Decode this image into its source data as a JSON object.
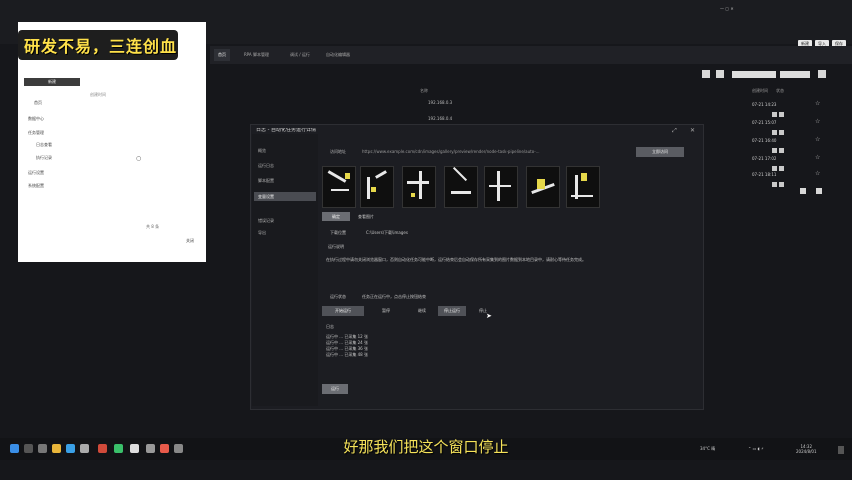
{
  "banner": {
    "text": "研发不易，三连创血"
  },
  "subtitle": "好那我们把这个窗口停止",
  "browser": {
    "tabs": [
      "首页",
      "RPA 脚本管理",
      "调试 / 运行",
      "自动化编辑器"
    ],
    "right_buttons": [
      "新建",
      "导入",
      "保存"
    ]
  },
  "list": {
    "col_a": "名称",
    "col_b": "创建时间",
    "col_c": "状态",
    "rows": [
      {
        "name": "任务 1",
        "time": "07-21 14:23"
      },
      {
        "name": "任务 2",
        "time": "07-21 15:07"
      },
      {
        "name": "任务 3",
        "time": "07-21 16:40"
      },
      {
        "name": "任务 4",
        "time": "07-21 17:02"
      },
      {
        "name": "任务 5",
        "time": "07-21 18:11"
      }
    ],
    "top_rows": [
      "192.168.0.3",
      "192.168.0.4"
    ]
  },
  "panel": {
    "button": "新建",
    "items": [
      "首页",
      "数据中心",
      "任务管理",
      "日志查看",
      "执行记录",
      "运行设置",
      "系统配置"
    ],
    "bottom_text": "共 8 条",
    "footer_button": "关闭"
  },
  "dialog": {
    "title": "日志 - 自动化任务运行详情",
    "side": [
      "概览",
      "运行日志",
      "脚本配置",
      "变量设置",
      "错误记录",
      "导出"
    ],
    "active_side": 3,
    "url_label": "访问地址",
    "url_text": "https://www.example.com/cdn/images/gallery/preview/render/node-task-pipeline/auto-...",
    "go_button": "立即访问",
    "btn_a": "确定",
    "btn_b": "查看图片",
    "field1_label": "下载位置",
    "field1_value": "C:\\Users\\下载\\images",
    "note_label": "运行说明",
    "note_text": "在执行过程中请勿关闭浏览器窗口，否则自动化任务可能中断，运行结束后会自动保存所有采集到的图片数据到本地目录中，请耐心等待任务完成。",
    "field2_label": "运行状态",
    "field2_value": "任务正在运行中，点击停止按钮结束",
    "tabs": [
      "开始运行",
      "暂停",
      "继续",
      "停止运行"
    ],
    "tab_extra": "停止",
    "log_title": "日志",
    "log_lines": [
      "运行中 ... 已采集 12 张",
      "运行中 ... 已采集 24 张",
      "运行中 ... 已采集 36 张",
      "运行中 ... 已采集 48 张"
    ],
    "run_button": "运行"
  },
  "tray": {
    "weather": "34°C 晴",
    "time": "14:32",
    "date": "2024/8/01"
  }
}
